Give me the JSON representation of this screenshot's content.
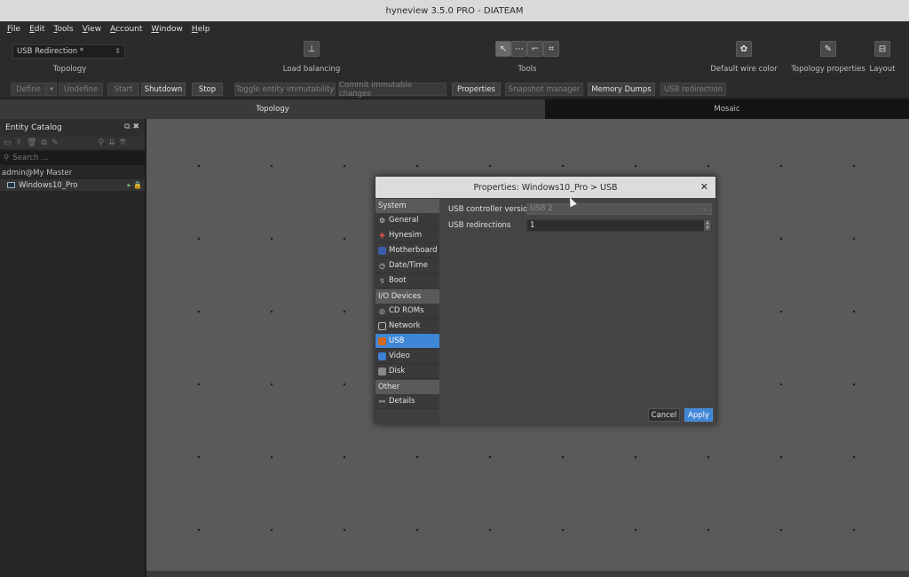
{
  "window": {
    "title": "hyneview 3.5.0 PRO - DIATEAM"
  },
  "menu": [
    "File",
    "Edit",
    "Tools",
    "View",
    "Account",
    "Window",
    "Help"
  ],
  "toolbar": {
    "topology_select": "USB Redirection *",
    "topology_label": "Topology",
    "load_balancing_label": "Load balancing",
    "tools_label": "Tools",
    "wire_color_label": "Default wire color",
    "topology_properties_label": "Topology properties",
    "layout_label": "Layout"
  },
  "actions": {
    "define": "Define",
    "undefine": "Undefine",
    "start": "Start",
    "shutdown": "Shutdown",
    "stop": "Stop",
    "toggle": "Toggle entity immutability",
    "commit": "Commit immutable changes",
    "properties": "Properties",
    "snapshot": "Snapshot manager",
    "memory": "Memory Dumps",
    "usb": "USB redirection"
  },
  "tabs": {
    "topology": "Topology",
    "mosaic": "Mosaic"
  },
  "catalog": {
    "title": "Entity Catalog",
    "search_placeholder": "Search ...",
    "node": "admin@My Master",
    "entity": "Windows10_Pro"
  },
  "dialog": {
    "title": "Properties: Windows10_Pro > USB",
    "sections": {
      "system": "System",
      "io": "I/O Devices",
      "other": "Other"
    },
    "items": {
      "general": "General",
      "hynesim": "Hynesim",
      "motherboard": "Motherboard",
      "datetime": "Date/Time",
      "boot": "Boot",
      "cdroms": "CD ROMs",
      "network": "Network",
      "usb": "USB",
      "video": "Video",
      "disk": "Disk",
      "details": "Details"
    },
    "fields": {
      "controller_label": "USB controller version",
      "controller_value": "USB 2",
      "redirections_label": "USB redirections",
      "redirections_value": "1"
    },
    "cancel": "Cancel",
    "apply": "Apply"
  },
  "colors": {
    "accent": "#3f86d6",
    "canvas": "#5a5a5a"
  }
}
